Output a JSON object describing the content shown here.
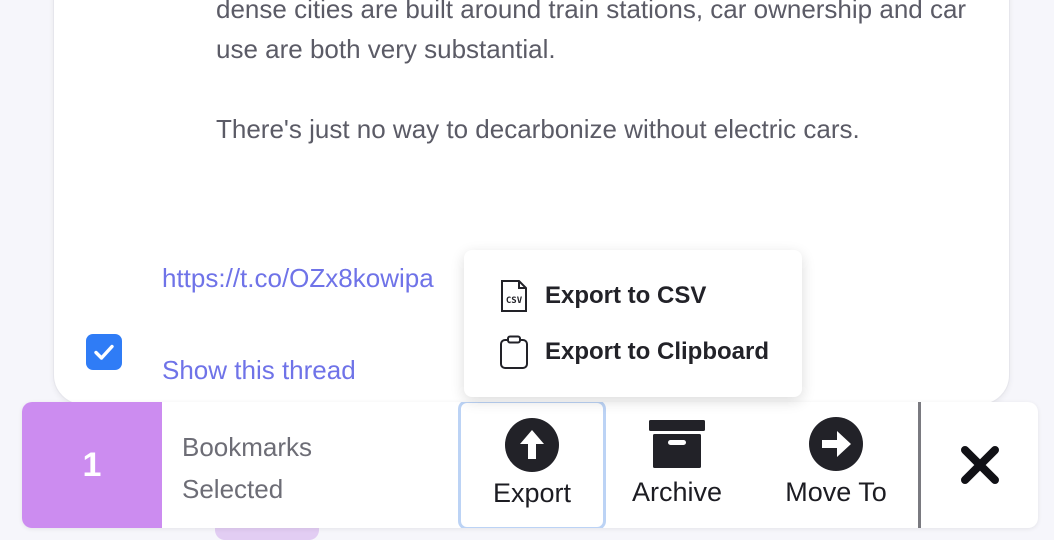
{
  "tweet": {
    "paragraphs": [
      "Even in countries where transit systems are top-notch and hyper-dense cities are built around train stations, car ownership and car use are both very substantial.",
      "There's just no way to decarbonize without electric cars."
    ],
    "link_text": "https://t.co/OZx8kowipa",
    "show_thread_label": "Show this thread",
    "selected": true
  },
  "export_menu": {
    "items": [
      {
        "label": "Export to CSV",
        "icon": "csv-file-icon"
      },
      {
        "label": "Export to Clipboard",
        "icon": "clipboard-icon"
      }
    ]
  },
  "action_bar": {
    "selected_count": "1",
    "selected_label_line1": "Bookmarks",
    "selected_label_line2": "Selected",
    "export_label": "Export",
    "archive_label": "Archive",
    "move_label": "Move To"
  },
  "colors": {
    "accent_purple": "#cc8cf0",
    "link_blue": "#6f73e8",
    "checkbox_blue": "#2f7cf6",
    "focus_ring": "#bcd3f5"
  }
}
